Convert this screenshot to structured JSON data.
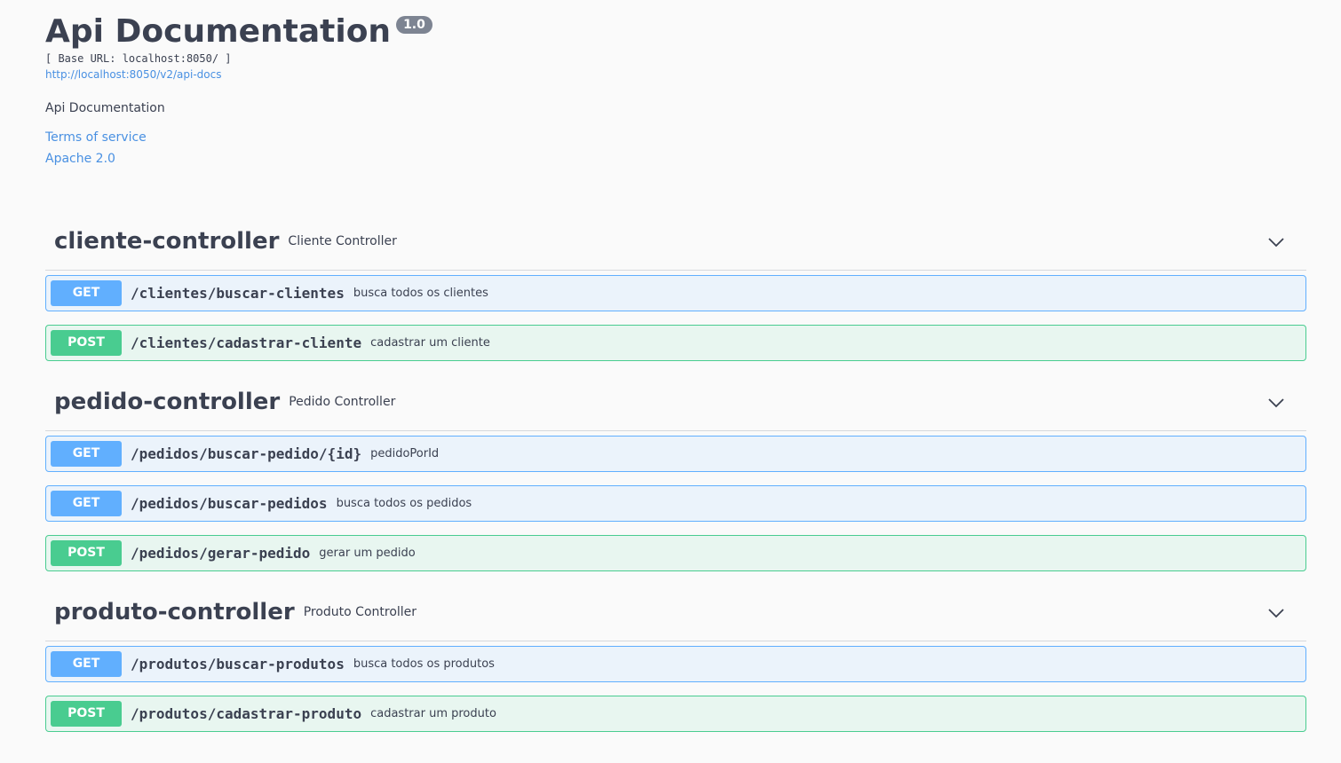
{
  "info": {
    "title": "Api Documentation",
    "version": "1.0",
    "base_url": "[ Base URL: localhost:8050/ ]",
    "docs_link": "http://localhost:8050/v2/api-docs",
    "description": "Api Documentation",
    "terms": "Terms of service",
    "license": "Apache 2.0"
  },
  "colors": {
    "get": "#61affe",
    "post": "#49cc90",
    "link": "#4990e2",
    "text": "#3b4151"
  },
  "tags": [
    {
      "name": "cliente-controller",
      "description": "Cliente Controller",
      "icon": "chevron-down-icon",
      "operations": [
        {
          "method": "GET",
          "path": "/clientes/buscar-clientes",
          "summary": "busca todos os clientes"
        },
        {
          "method": "POST",
          "path": "/clientes/cadastrar-cliente",
          "summary": "cadastrar um cliente"
        }
      ]
    },
    {
      "name": "pedido-controller",
      "description": "Pedido Controller",
      "icon": "chevron-down-icon",
      "operations": [
        {
          "method": "GET",
          "path": "/pedidos/buscar-pedido/{id}",
          "summary": "pedidoPorId"
        },
        {
          "method": "GET",
          "path": "/pedidos/buscar-pedidos",
          "summary": "busca todos os pedidos"
        },
        {
          "method": "POST",
          "path": "/pedidos/gerar-pedido",
          "summary": "gerar um pedido"
        }
      ]
    },
    {
      "name": "produto-controller",
      "description": "Produto Controller",
      "icon": "chevron-down-icon",
      "operations": [
        {
          "method": "GET",
          "path": "/produtos/buscar-produtos",
          "summary": "busca todos os produtos"
        },
        {
          "method": "POST",
          "path": "/produtos/cadastrar-produto",
          "summary": "cadastrar um produto"
        }
      ]
    }
  ]
}
